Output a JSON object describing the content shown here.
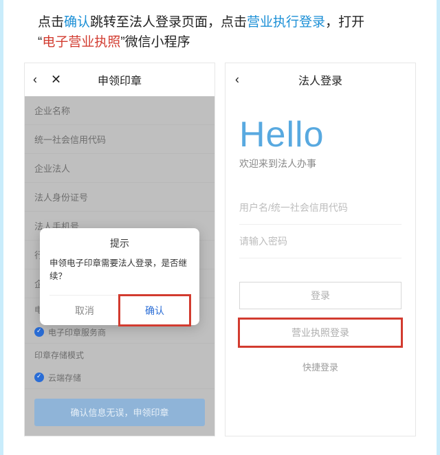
{
  "instructions": {
    "p1a": "点击",
    "p1b": "确认",
    "p1c": "跳转至法人登录页面，点击",
    "p1d": "营业执行登录",
    "p1e": "，打开",
    "p2a": "“",
    "p2b": "电子营业执照",
    "p2c": "”微信小程序"
  },
  "left": {
    "title": "申领印章",
    "fields": [
      "企业名称",
      "统一社会信用代码",
      "企业法人",
      "法人身份证号",
      "法人手机号",
      "行",
      "企"
    ],
    "sectionA": "电子",
    "radioA": "电子印章服务商",
    "sectionB": "印章存储模式",
    "radioB": "云端存储",
    "bottomBtn": "确认信息无误，申领印章",
    "modal": {
      "title": "提示",
      "body": "申领电子印章需要法人登录，是否继续？",
      "cancel": "取消",
      "confirm": "确认"
    }
  },
  "right": {
    "title": "法人登录",
    "hello": "Hello",
    "welcome": "欢迎来到法人办事",
    "userPlaceholder": "用户名/统一社会信用代码",
    "pwdPlaceholder": "请输入密码",
    "loginBtn": "登录",
    "licenseBtn": "营业执照登录",
    "quickBtn": "快捷登录"
  }
}
